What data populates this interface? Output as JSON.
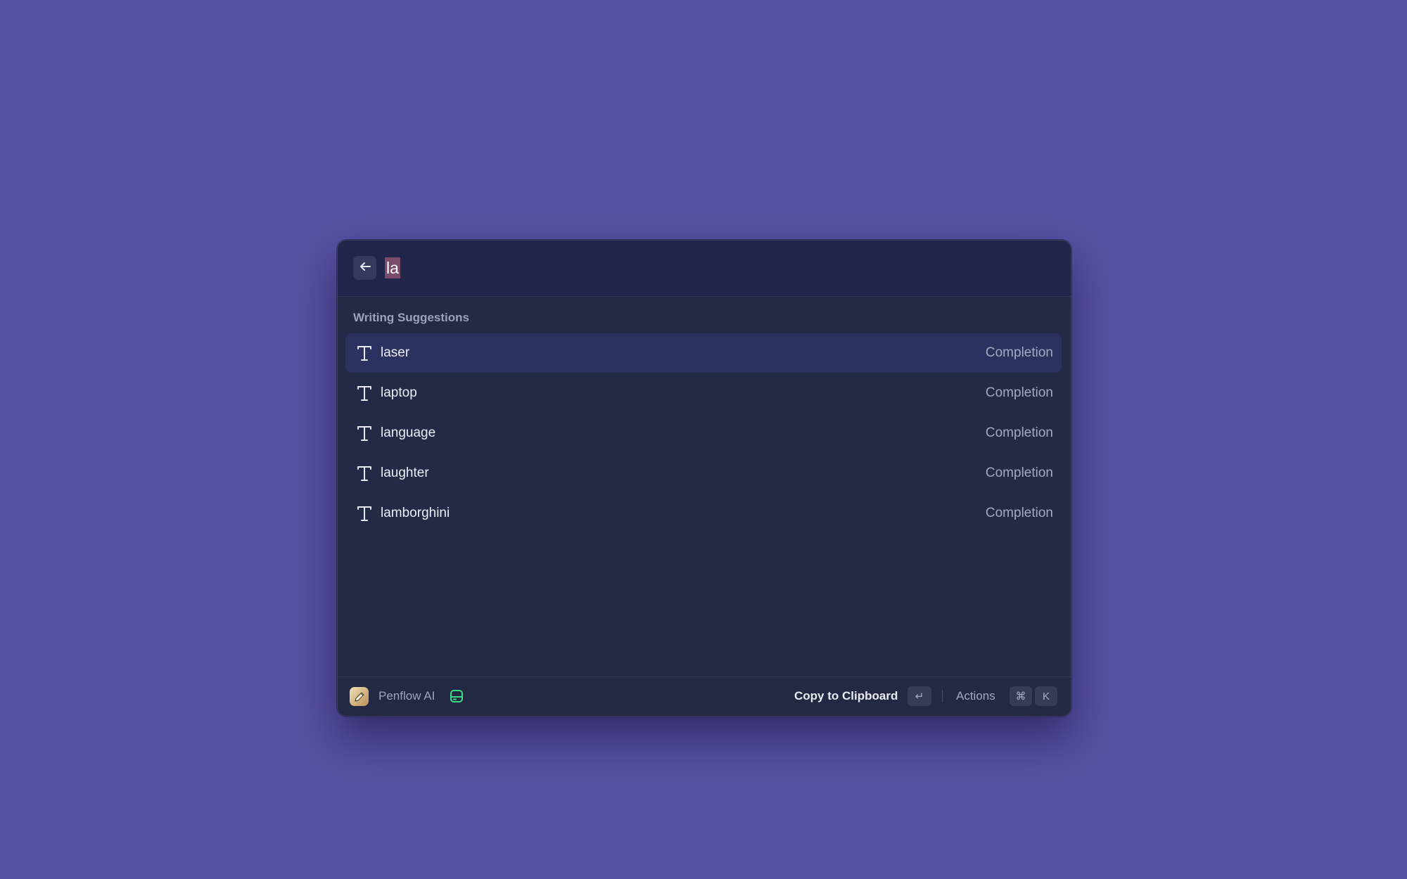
{
  "search": {
    "query": "la"
  },
  "section": {
    "title": "Writing Suggestions"
  },
  "items": [
    {
      "title": "laser",
      "type": "Completion",
      "selected": true
    },
    {
      "title": "laptop",
      "type": "Completion"
    },
    {
      "title": "language",
      "type": "Completion"
    },
    {
      "title": "laughter",
      "type": "Completion"
    },
    {
      "title": "lamborghini",
      "type": "Completion"
    }
  ],
  "footer": {
    "app_name": "Penflow AI",
    "primary_action": "Copy to Clipboard",
    "primary_shortcut": "↵",
    "actions_label": "Actions",
    "actions_shortcut": [
      "⌘",
      "K"
    ]
  },
  "icons": {
    "back": "arrow-left-icon",
    "item": "text-t-icon",
    "app": "pencil-icon",
    "status": "drive-icon"
  },
  "colors": {
    "background": "#5651a2",
    "window": "#242946",
    "selected_row": "#2c3260",
    "status_green": "#3ddc84",
    "query_highlight": "#7a4b6a"
  }
}
